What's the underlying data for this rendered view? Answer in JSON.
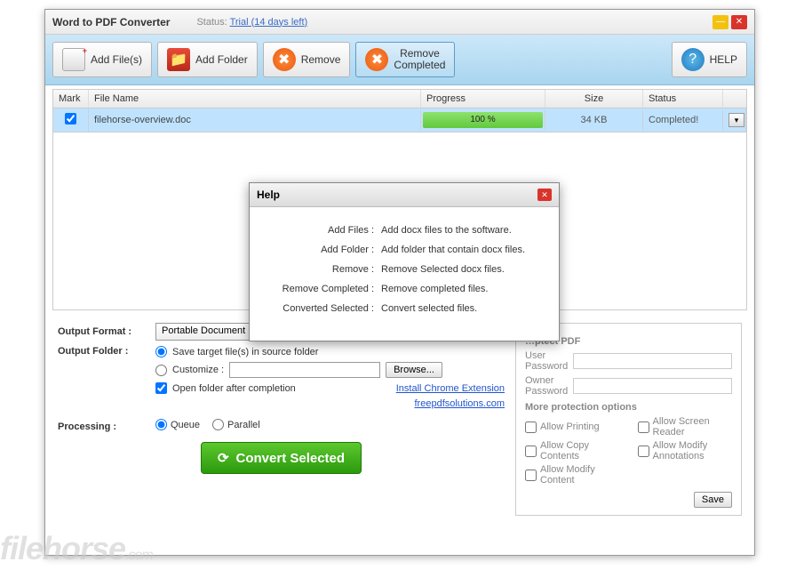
{
  "titlebar": {
    "title": "Word to PDF Converter",
    "status_label": "Status:",
    "status_link": "Trial (14 days left)"
  },
  "toolbar": {
    "add_files": "Add File(s)",
    "add_folder": "Add Folder",
    "remove": "Remove",
    "remove_completed_l1": "Remove",
    "remove_completed_l2": "Completed",
    "help": "HELP"
  },
  "table": {
    "headers": {
      "mark": "Mark",
      "name": "File Name",
      "progress": "Progress",
      "size": "Size",
      "status": "Status"
    },
    "rows": [
      {
        "checked": true,
        "name": "filehorse-overview.doc",
        "progress": "100 %",
        "size": "34 KB",
        "status": "Completed!"
      }
    ]
  },
  "options": {
    "output_format_label": "Output Format :",
    "output_format_value": "Portable Document",
    "output_folder_label": "Output Folder :",
    "save_source": "Save target file(s) in source folder",
    "customize": "Customize :",
    "browse": "Browse...",
    "open_after": "Open folder after completion",
    "install_ext": "Install Chrome Extension",
    "site_link": "freepdfsolutions.com",
    "processing_label": "Processing :",
    "queue": "Queue",
    "parallel": "Parallel",
    "convert": "Convert Selected"
  },
  "protect": {
    "title": "…ptect PDF",
    "user_pw": "User Password",
    "owner_pw": "Owner Password",
    "more_title": "More protection options",
    "allow_print": "Allow Printing",
    "allow_screen": "Allow Screen Reader",
    "allow_copy": "Allow Copy Contents",
    "allow_annot": "Allow Modify Annotations",
    "allow_modify": "Allow Modify Content",
    "save": "Save"
  },
  "help": {
    "title": "Help",
    "rows": [
      {
        "k": "Add Files  :",
        "v": "Add docx files to the software."
      },
      {
        "k": "Add Folder  :",
        "v": "Add folder that contain docx files."
      },
      {
        "k": "Remove  :",
        "v": "Remove Selected docx files."
      },
      {
        "k": "Remove Completed  :",
        "v": "Remove completed files."
      },
      {
        "k": "Converted Selected  :",
        "v": "Convert selected files."
      }
    ]
  },
  "watermark": {
    "brand": "filehorse",
    "dom": ".com"
  }
}
